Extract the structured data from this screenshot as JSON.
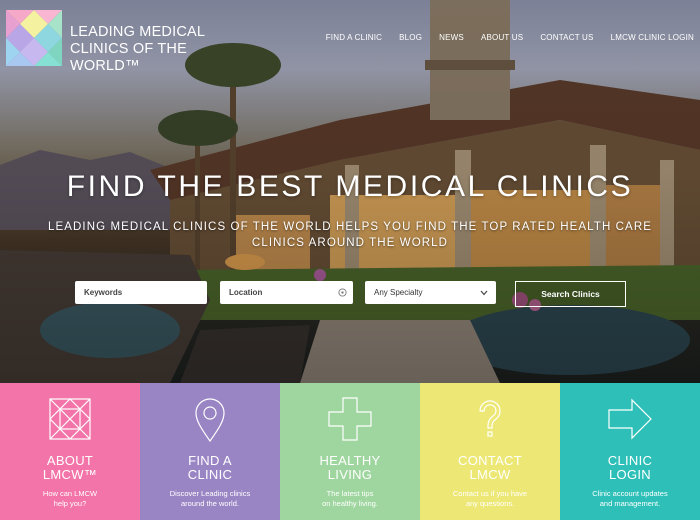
{
  "brand": {
    "name": "LEADING MEDICAL CLINICS OF THE WORLD™",
    "logo_icon": "geometric-triangle-logo"
  },
  "nav": {
    "items": [
      {
        "label": "FIND A CLINIC"
      },
      {
        "label": "BLOG"
      },
      {
        "label": "NEWS"
      },
      {
        "label": "ABOUT US"
      },
      {
        "label": "CONTACT US"
      },
      {
        "label": "LMCW CLINIC LOGIN"
      }
    ]
  },
  "hero": {
    "headline": "FIND THE BEST MEDICAL CLINICS",
    "subline": "LEADING MEDICAL CLINICS OF THE WORLD HELPS YOU FIND THE TOP RATED HEALTH CARE CLINICS AROUND THE WORLD"
  },
  "search": {
    "keywords_placeholder": "Keywords",
    "location_placeholder": "Location",
    "location_icon": "target-icon",
    "specialty_selected": "Any Specialty",
    "button_label": "Search Clinics"
  },
  "tiles": [
    {
      "title_line1": "ABOUT",
      "title_line2": "LMCW™",
      "desc_line1": "How can LMCW",
      "desc_line2": "help you?",
      "color": "#f274a8",
      "icon": "diamond-grid-icon"
    },
    {
      "title_line1": "FIND A",
      "title_line2": "CLINIC",
      "desc_line1": "Discover Leading clinics",
      "desc_line2": "around the world.",
      "color": "#9a85c4",
      "icon": "map-pin-icon"
    },
    {
      "title_line1": "HEALTHY",
      "title_line2": "LIVING",
      "desc_line1": "The latest tips",
      "desc_line2": "on healthy living.",
      "color": "#9fd69f",
      "icon": "plus-cross-icon"
    },
    {
      "title_line1": "CONTACT",
      "title_line2": "LMCW",
      "desc_line1": "Contact us if you have",
      "desc_line2": "any questions.",
      "color": "#ede875",
      "icon": "question-mark-icon"
    },
    {
      "title_line1": "CLINIC",
      "title_line2": "LOGIN",
      "desc_line1": "Clinic account updates",
      "desc_line2": "and management.",
      "color": "#2ec0b8",
      "icon": "arrow-right-icon"
    }
  ]
}
